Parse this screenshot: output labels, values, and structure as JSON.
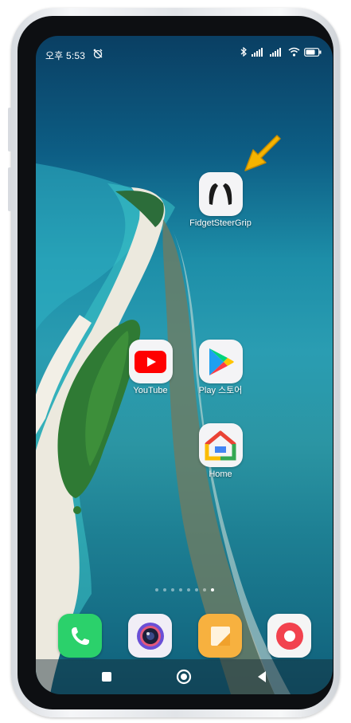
{
  "status_bar": {
    "time": "오후 5:53"
  },
  "home_apps": [
    {
      "label": "FidgetSteerGrip",
      "icon": "grip-handles-icon"
    },
    {
      "label": "YouTube",
      "icon": "youtube-play-icon"
    },
    {
      "label": "Play 스토어",
      "icon": "play-store-icon"
    },
    {
      "label": "Home",
      "icon": "google-home-icon"
    }
  ],
  "page_indicator": {
    "total": 8,
    "current": 8
  },
  "dock": [
    {
      "icon": "phone-icon",
      "color": "#2bd16b"
    },
    {
      "icon": "camera-icon",
      "color": "#f1eef6"
    },
    {
      "icon": "notes-icon",
      "color": "#f7b13f"
    },
    {
      "icon": "screen-recorder-icon",
      "color": "#f5f5f5"
    }
  ],
  "navigation": {
    "buttons": [
      "recents",
      "home",
      "back"
    ]
  },
  "annotation": {
    "arrow_color": "#f5b400"
  }
}
